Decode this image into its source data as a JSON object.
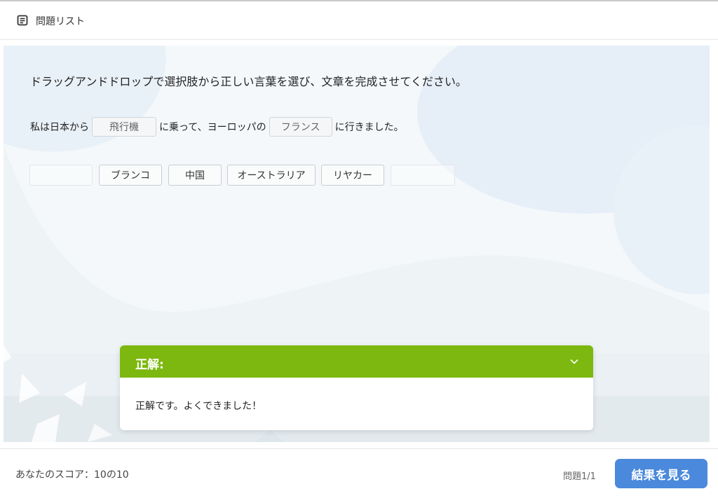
{
  "header": {
    "title": "問題リスト",
    "icon": "list-icon"
  },
  "question": {
    "instruction": "ドラッグアンドドロップで選択肢から正しい言葉を選び、文章を完成させてください。",
    "sentence": {
      "part1": "私は日本から",
      "blank1": "飛行機",
      "part2": "に乗って、ヨーロッパの",
      "blank2": "フランス",
      "part3": "に行きました。"
    },
    "choices": [
      "",
      "ブランコ",
      "中国",
      "オーストラリア",
      "リヤカー",
      ""
    ]
  },
  "feedback": {
    "title": "正解:",
    "message": "正解です。よくできました！",
    "header_color": "#7cb80f"
  },
  "footer": {
    "score": "あなたのスコア：10の10",
    "counter": "問題1/1",
    "results_button": "結果を見る",
    "button_color": "#4a89dc"
  }
}
